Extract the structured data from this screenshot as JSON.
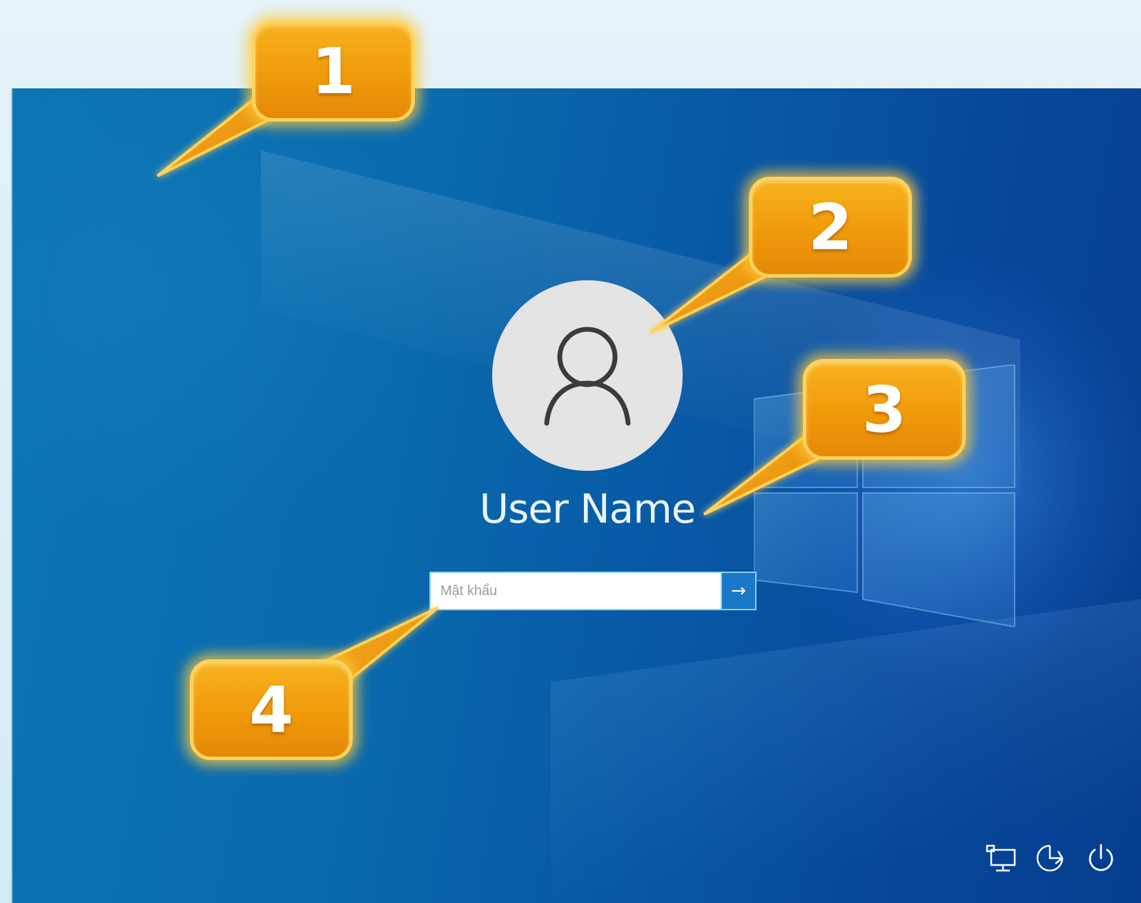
{
  "login": {
    "user_name": "User Name",
    "password_placeholder": "Mật khẩu",
    "submit_symbol": "→"
  },
  "system_icons": [
    {
      "name": "network-icon"
    },
    {
      "name": "accessibility-icon"
    },
    {
      "name": "power-icon"
    }
  ],
  "callouts": [
    {
      "label": "1"
    },
    {
      "label": "2"
    },
    {
      "label": "3"
    },
    {
      "label": "4"
    }
  ],
  "colors": {
    "background_blue": "#0a6aad",
    "callout_orange": "#f09a0a",
    "callout_glow": "#ffd35a",
    "avatar_bg": "#e4e4e4",
    "submit_bg": "#1a78c8"
  }
}
